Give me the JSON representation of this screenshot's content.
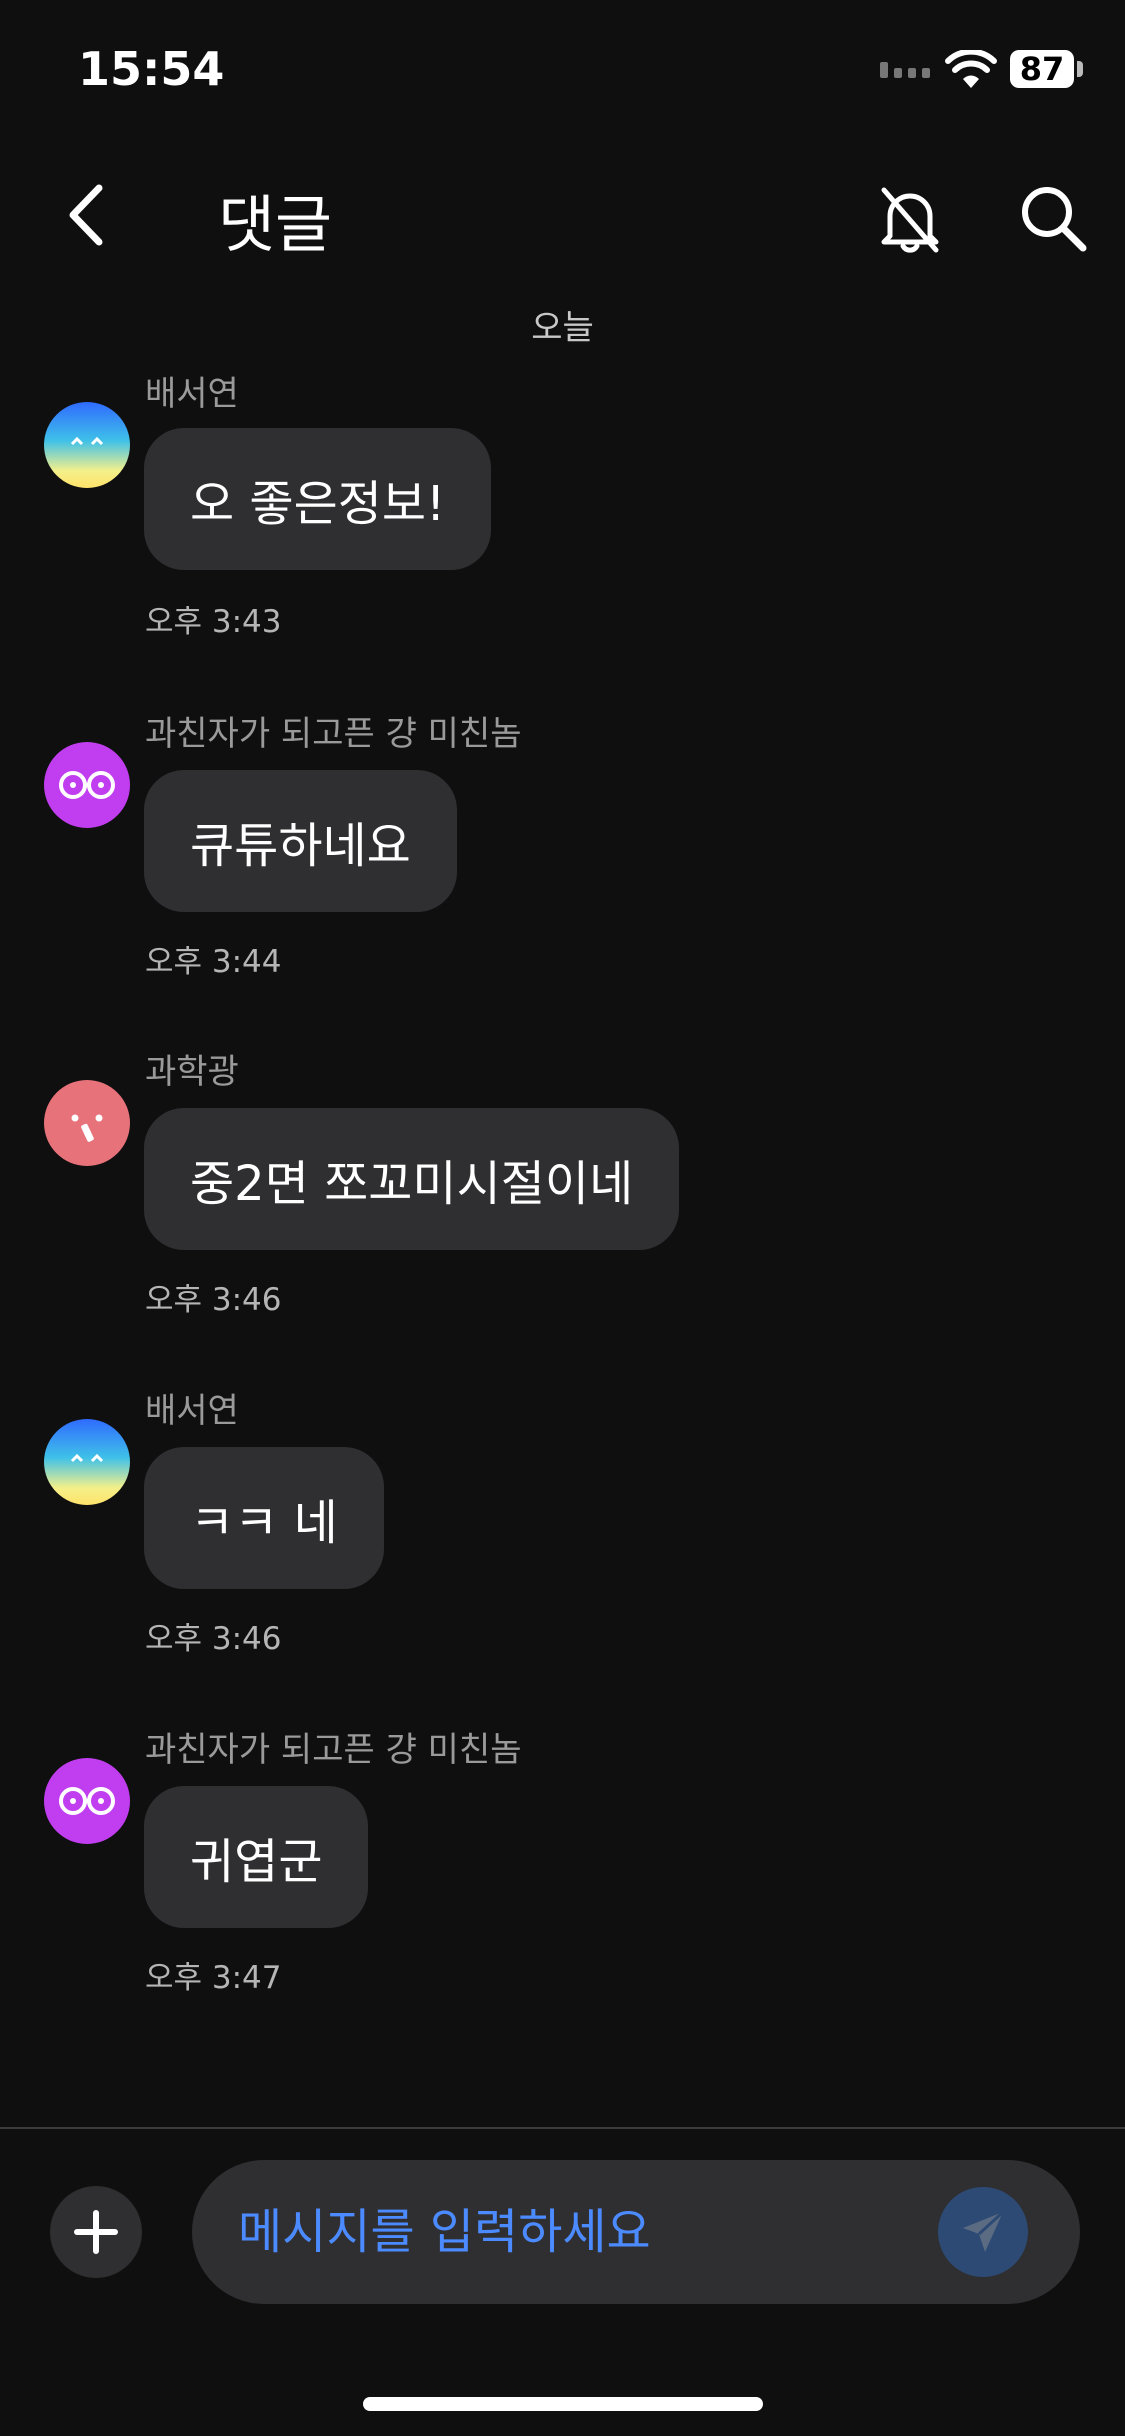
{
  "status_bar": {
    "time": "15:54",
    "battery": "87"
  },
  "header": {
    "title": "댓글",
    "icons": [
      "back-chevron-icon",
      "bell-off-icon",
      "search-icon"
    ]
  },
  "date_separator": "오늘",
  "messages": [
    {
      "sender": "배서연",
      "text": "오 좋은정보!",
      "time": "오후 3:43",
      "avatar": "smile-gradient-avatar"
    },
    {
      "sender": "과친자가 되고픈 걍 미친놈",
      "text": "큐튜하네요",
      "time": "오후 3:44",
      "avatar": "glasses-purple-avatar"
    },
    {
      "sender": "과학광",
      "text": "중2면 쪼꼬미시절이네",
      "time": "오후 3:46",
      "avatar": "pink-face-avatar"
    },
    {
      "sender": "배서연",
      "text": "ㅋㅋ 네",
      "time": "오후 3:46",
      "avatar": "smile-gradient-avatar"
    },
    {
      "sender": "과친자가 되고픈 걍 미친놈",
      "text": "귀엽군",
      "time": "오후 3:47",
      "avatar": "glasses-purple-avatar"
    }
  ],
  "composer": {
    "placeholder": "메시지를 입력하세요"
  },
  "colors": {
    "background": "#0f0f10",
    "bubble": "#2f2f31",
    "placeholder": "#4c8bff",
    "send_button": "#2d4a74",
    "avatar_purple": "#c13ef0",
    "avatar_pink": "#e8727a"
  }
}
